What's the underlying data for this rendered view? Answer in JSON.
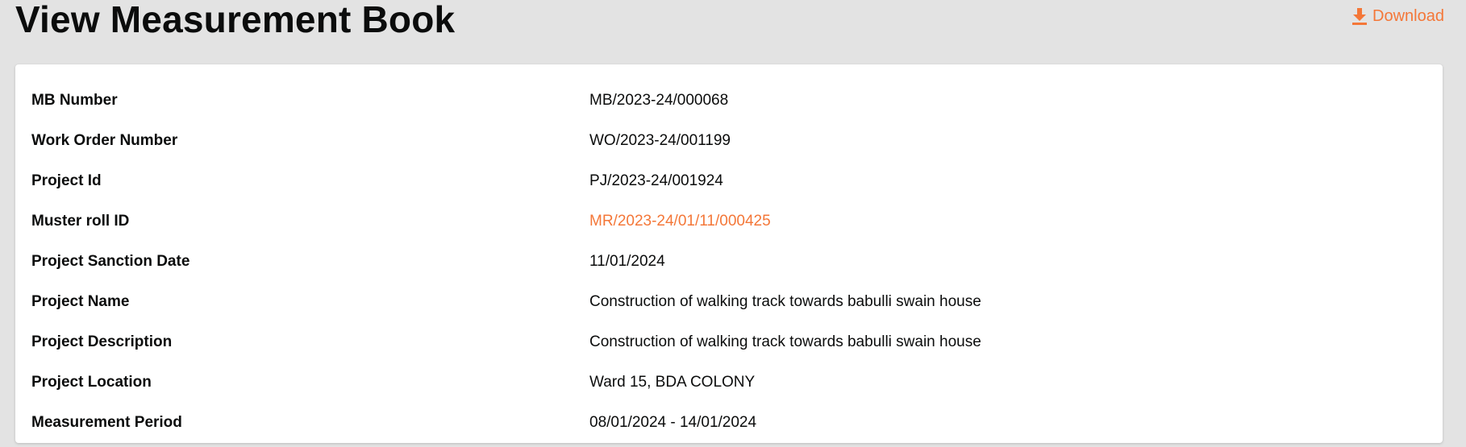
{
  "page": {
    "title": "View Measurement Book",
    "download_label": "Download"
  },
  "colors": {
    "accent": "#f47738",
    "background": "#e3e3e3",
    "card": "#ffffff",
    "text": "#0b0c0c"
  },
  "details": [
    {
      "label": "MB Number",
      "value": "MB/2023-24/000068"
    },
    {
      "label": "Work Order Number",
      "value": "WO/2023-24/001199"
    },
    {
      "label": "Project Id",
      "value": "PJ/2023-24/001924"
    },
    {
      "label": "Muster roll ID",
      "value": "MR/2023-24/01/11/000425"
    },
    {
      "label": "Project Sanction Date",
      "value": "11/01/2024"
    },
    {
      "label": "Project Name",
      "value": "Construction of walking track towards babulli swain house"
    },
    {
      "label": "Project Description",
      "value": "Construction of walking track towards babulli swain house"
    },
    {
      "label": "Project Location",
      "value": "Ward 15, BDA COLONY"
    },
    {
      "label": "Measurement Period",
      "value": "08/01/2024 - 14/01/2024"
    }
  ]
}
